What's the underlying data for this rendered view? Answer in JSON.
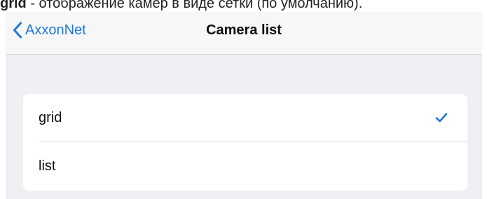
{
  "caption": {
    "bold": "grid",
    "text": " - отображение камер в виде сетки (по умолчанию)."
  },
  "navbar": {
    "back_label": "AxxonNet",
    "title": "Camera list"
  },
  "options": [
    {
      "label": "grid",
      "selected": true
    },
    {
      "label": "list",
      "selected": false
    }
  ],
  "colors": {
    "accent": "#1f78d8",
    "background": "#efeff4",
    "navbar": "#f7f7f7"
  },
  "icons": {
    "back": "chevron-left-icon",
    "check": "checkmark-icon"
  }
}
